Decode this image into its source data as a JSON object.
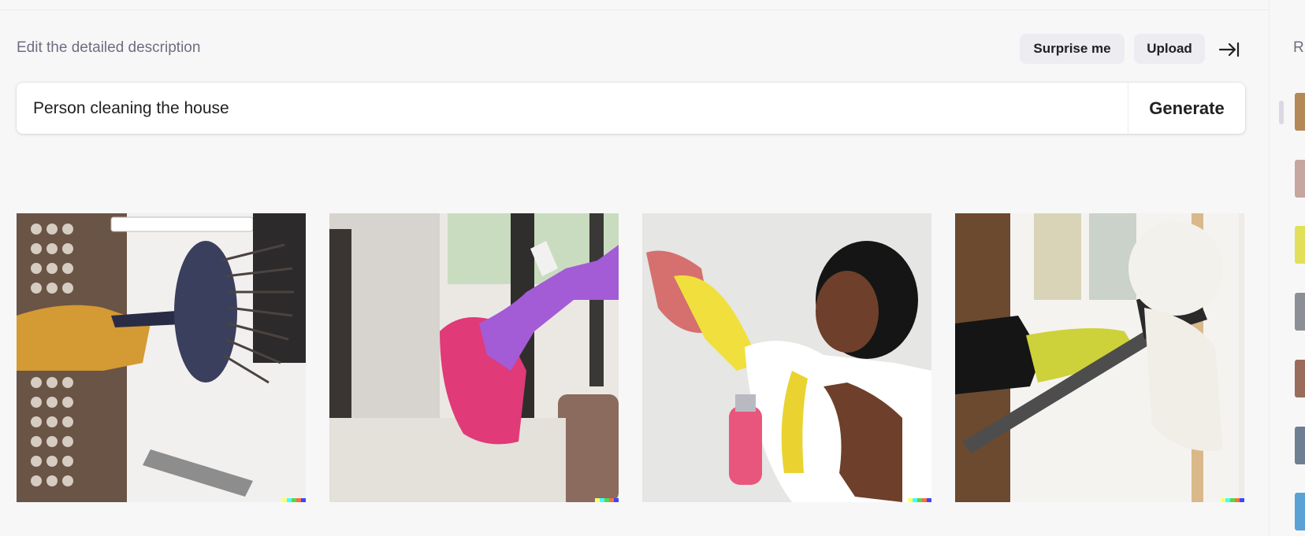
{
  "prompt_section": {
    "label": "Edit the detailed description",
    "surprise_label": "Surprise me",
    "upload_label": "Upload",
    "collapse_icon": "collapse-right-icon",
    "input_value": "Person cleaning the house",
    "input_placeholder": "Person cleaning the house",
    "generate_label": "Generate"
  },
  "results": [
    {
      "name": "result-image-1",
      "subject": "gloved hand holding a scrub brush"
    },
    {
      "name": "result-image-2",
      "subject": "purple-gloved hand holding a pink cloth"
    },
    {
      "name": "result-image-3",
      "subject": "woman wiping a wall with a cloth and spray bottle"
    },
    {
      "name": "result-image-4",
      "subject": "yellow-gloved hand cleaning with a squeegee duster"
    }
  ],
  "sidebar": {
    "title": "R",
    "thumbnail_count": 8
  },
  "colors": {
    "background": "#f7f7f8",
    "panel": "#ffffff",
    "button_bg": "#ececf1",
    "text": "#202123",
    "muted": "#6e6e80",
    "signature": [
      "#ffff66",
      "#42ffff",
      "#51da4c",
      "#ff6e3c",
      "#3c46ff"
    ]
  }
}
